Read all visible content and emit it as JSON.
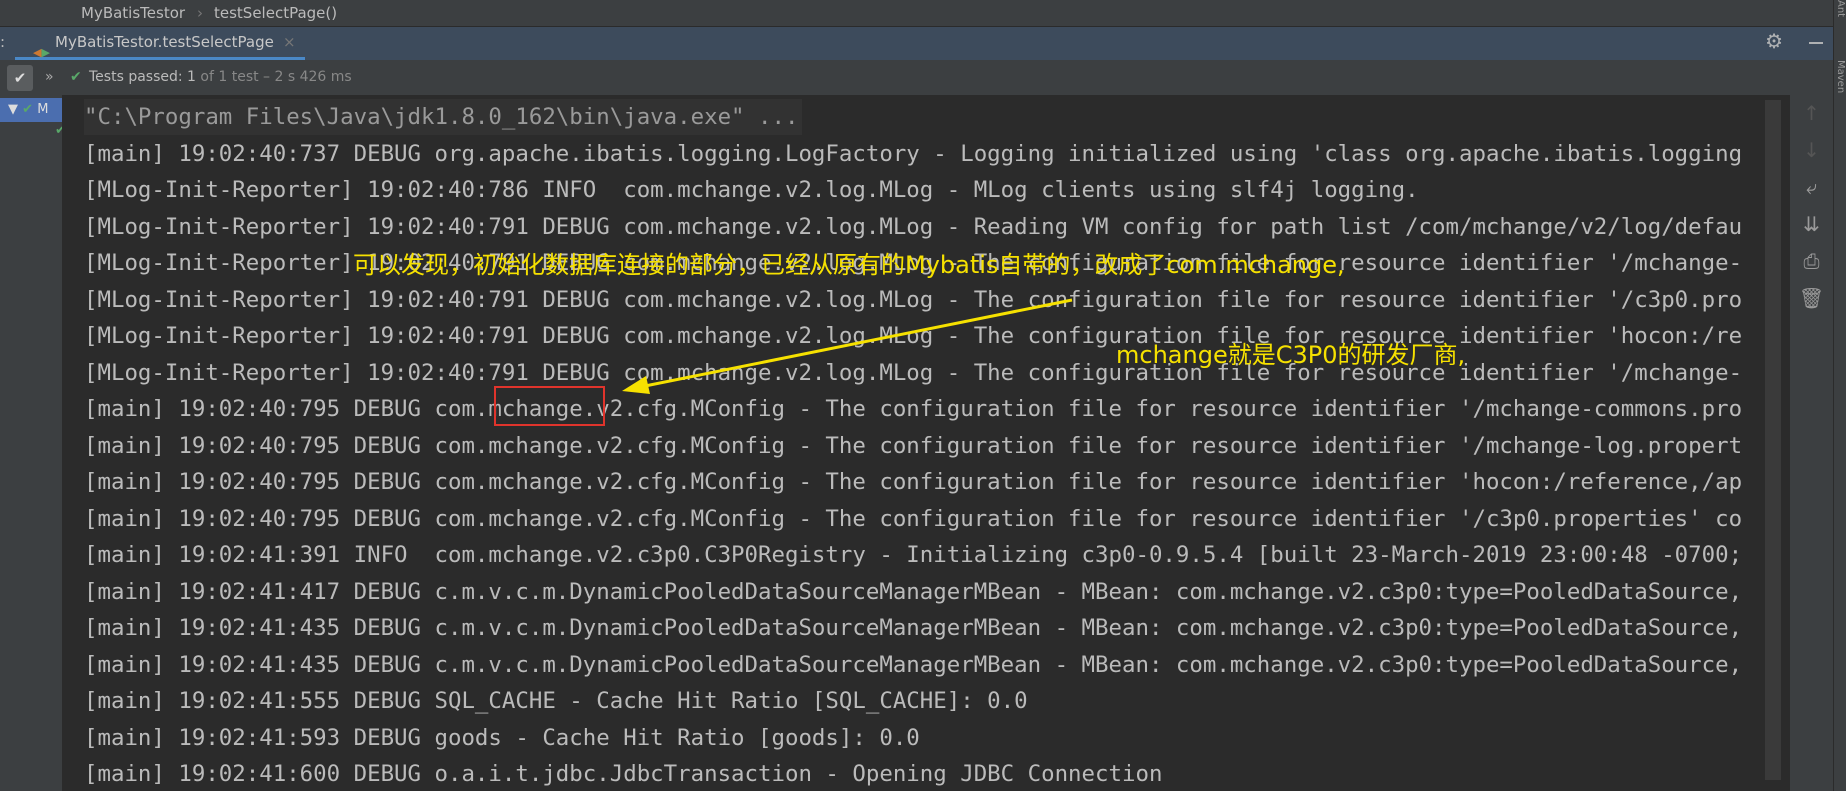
{
  "breadcrumb": {
    "class": "MyBatisTestor",
    "sep": "›",
    "method": "testSelectPage()"
  },
  "tab": {
    "label": "MyBatisTestor.testSelectPage",
    "close": "×",
    "left_marker": ":"
  },
  "toolbar": {
    "expand": "»",
    "status": "Tests passed:",
    "count": "1",
    "detail": "of 1 test – 2 s 426 ms"
  },
  "tree": {
    "root": "M"
  },
  "right_strip": {
    "ant": "Ant",
    "maven": "Maven"
  },
  "console": {
    "lines": [
      "\"C:\\Program Files\\Java\\jdk1.8.0_162\\bin\\java.exe\" ...",
      "[main] 19:02:40:737 DEBUG org.apache.ibatis.logging.LogFactory - Logging initialized using 'class org.apache.ibatis.logging",
      "[MLog-Init-Reporter] 19:02:40:786 INFO  com.mchange.v2.log.MLog - MLog clients using slf4j logging.",
      "[MLog-Init-Reporter] 19:02:40:791 DEBUG com.mchange.v2.log.MLog - Reading VM config for path list /com/mchange/v2/log/defau",
      "[MLog-Init-Reporter] 19:02:40:791 DEBUG com.mchange.v2.log.MLog - The configuration file for resource identifier '/mchange-",
      "[MLog-Init-Reporter] 19:02:40:791 DEBUG com.mchange.v2.log.MLog - The configuration file for resource identifier '/c3p0.pro",
      "[MLog-Init-Reporter] 19:02:40:791 DEBUG com.mchange.v2.log.MLog - The configuration file for resource identifier 'hocon:/re",
      "[MLog-Init-Reporter] 19:02:40:791 DEBUG com.mchange.v2.log.MLog - The configuration file for resource identifier '/mchange-",
      "[main] 19:02:40:795 DEBUG com.mchange.v2.cfg.MConfig - The configuration file for resource identifier '/mchange-commons.pro",
      "[main] 19:02:40:795 DEBUG com.mchange.v2.cfg.MConfig - The configuration file for resource identifier '/mchange-log.propert",
      "[main] 19:02:40:795 DEBUG com.mchange.v2.cfg.MConfig - The configuration file for resource identifier 'hocon:/reference,/ap",
      "[main] 19:02:40:795 DEBUG com.mchange.v2.cfg.MConfig - The configuration file for resource identifier '/c3p0.properties' co",
      "[main] 19:02:41:391 INFO  com.mchange.v2.c3p0.C3P0Registry - Initializing c3p0-0.9.5.4 [built 23-March-2019 23:00:48 -0700;",
      "[main] 19:02:41:417 DEBUG c.m.v.c.m.DynamicPooledDataSourceManagerMBean - MBean: com.mchange.v2.c3p0:type=PooledDataSource,",
      "[main] 19:02:41:435 DEBUG c.m.v.c.m.DynamicPooledDataSourceManagerMBean - MBean: com.mchange.v2.c3p0:type=PooledDataSource,",
      "[main] 19:02:41:435 DEBUG c.m.v.c.m.DynamicPooledDataSourceManagerMBean - MBean: com.mchange.v2.c3p0:type=PooledDataSource,",
      "[main] 19:02:41:555 DEBUG SQL_CACHE - Cache Hit Ratio [SQL_CACHE]: 0.0",
      "[main] 19:02:41:593 DEBUG goods - Cache Hit Ratio [goods]: 0.0",
      "[main] 19:02:41:600 DEBUG o.a.i.t.jdbc.JdbcTransaction - Opening JDBC Connection"
    ]
  },
  "annotations": {
    "note1": "可以发现，初始化数据库连接的部分，已经从原有的Mybatis自带的，改成了com.mchange,",
    "note2": "mchange就是C3P0的研发厂商,",
    "color": "#f6e100",
    "highlight_color": "#e0342c"
  }
}
